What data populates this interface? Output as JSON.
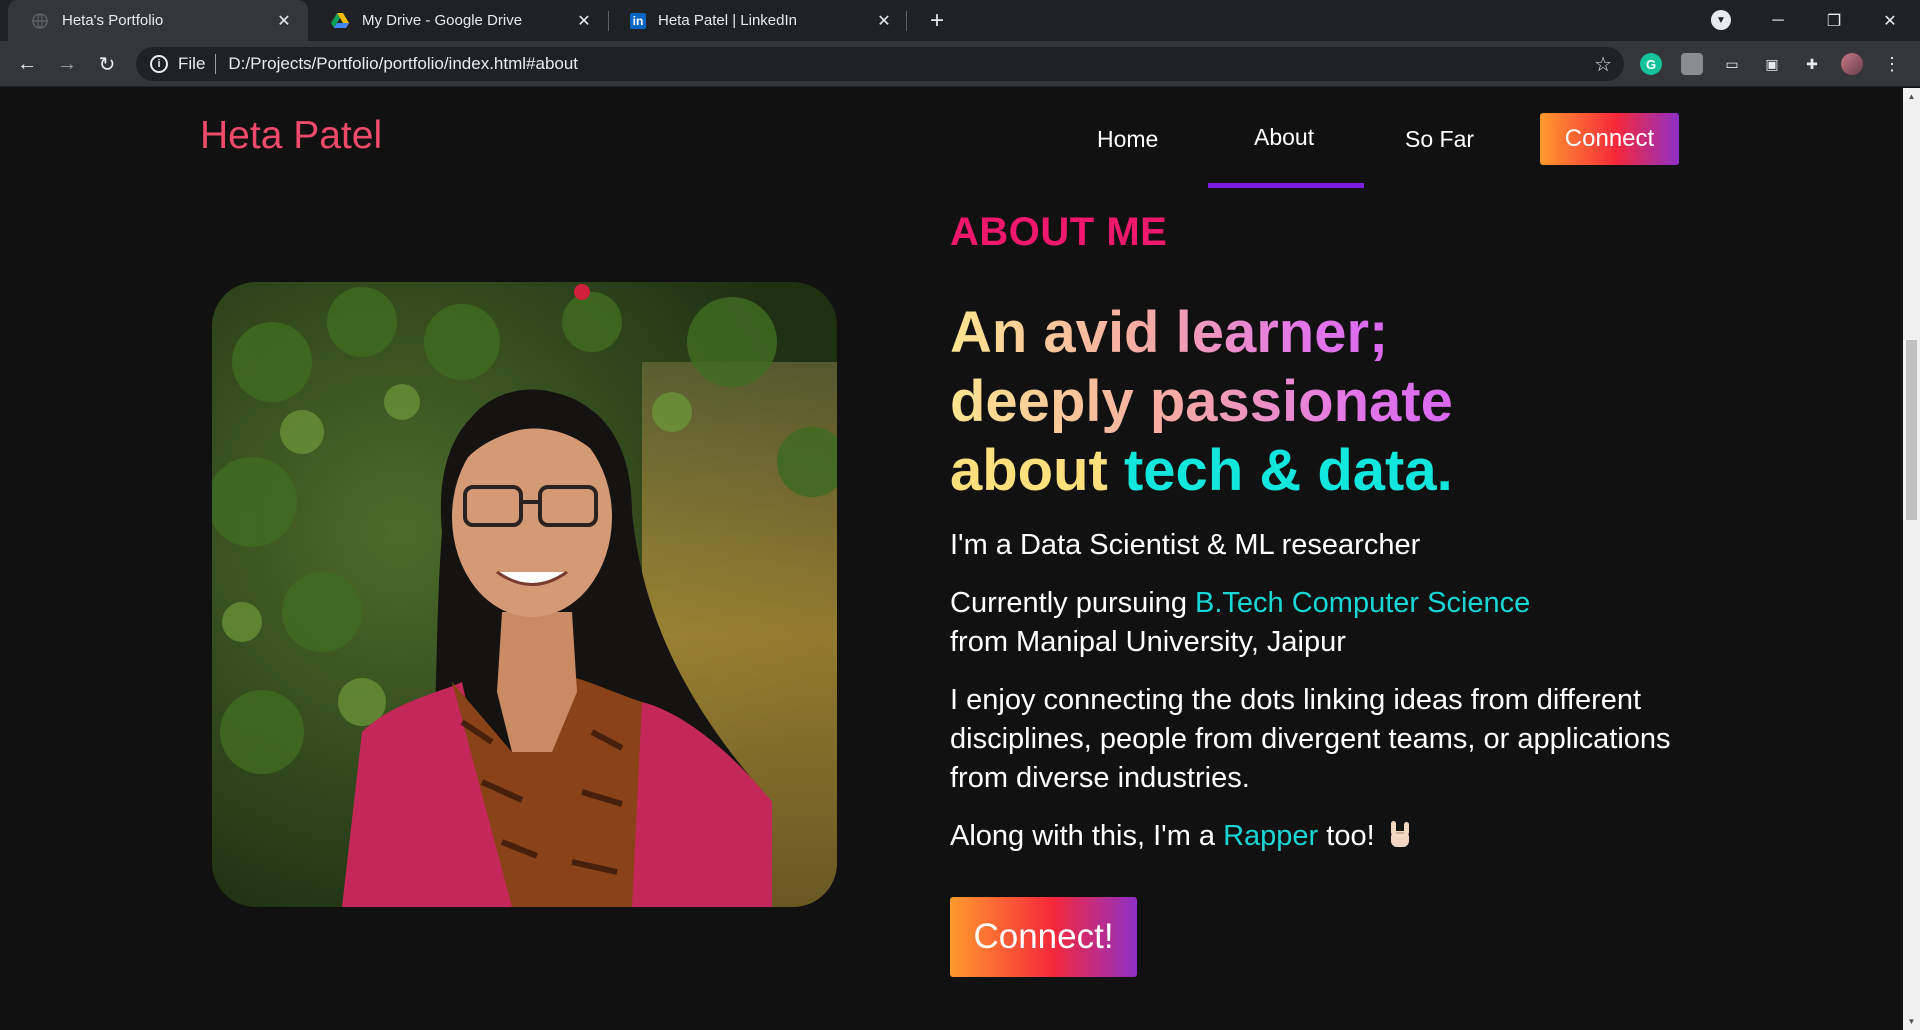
{
  "browser": {
    "tabs": [
      {
        "title": "Heta's Portfolio",
        "active": true,
        "icon": "globe-icon"
      },
      {
        "title": "My Drive - Google Drive",
        "active": false,
        "icon": "google-drive-icon"
      },
      {
        "title": "Heta Patel | LinkedIn",
        "active": false,
        "icon": "linkedin-icon"
      }
    ],
    "address": {
      "scheme": "File",
      "url": "D:/Projects/Portfolio/portfolio/index.html#about"
    }
  },
  "site": {
    "brand": "Heta Patel",
    "nav": {
      "home": "Home",
      "about": "About",
      "sofar": "So Far",
      "connect": "Connect",
      "active": "About"
    },
    "about": {
      "heading": "ABOUT ME",
      "tagline": {
        "part1": "An avid learner;",
        "part2": "deeply passionate",
        "part3": "about ",
        "part4": "tech & data."
      },
      "p1": "I'm a Data Scientist & ML researcher",
      "p2_pre": "Currently pursuing ",
      "p2_hl": "B.Tech Computer Science",
      "p2_post": "from Manipal University, Jaipur",
      "p3": "I enjoy connecting the dots linking ideas from different disciplines, people from divergent teams, or applications from diverse industries.",
      "p4_pre": "Along with this, I'm a ",
      "p4_hl": "Rapper",
      "p4_post": " too!",
      "cta": "Connect!"
    }
  },
  "colors": {
    "brand": "#ef4a6b",
    "heading": "#f0186d",
    "highlight": "#17d6d4",
    "nav_underline": "#7c1ddd"
  }
}
